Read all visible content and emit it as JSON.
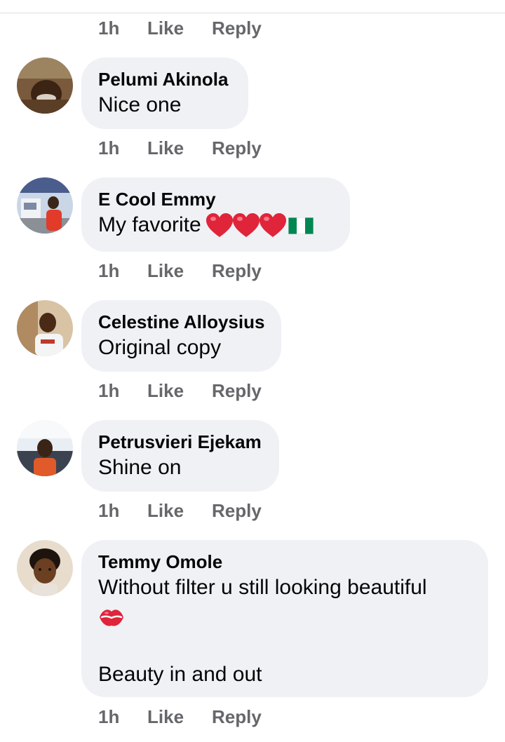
{
  "actions": {
    "time": "1h",
    "like": "Like",
    "reply": "Reply"
  },
  "comments": [
    {
      "author": "Pelumi Akinola",
      "text": "Nice one"
    },
    {
      "author": "E Cool Emmy",
      "text": "My favorite"
    },
    {
      "author": "Celestine Alloysius",
      "text": "Original copy"
    },
    {
      "author": "Petrusvieri Ejekam",
      "text": "Shine on"
    },
    {
      "author": "Temmy Omole",
      "text": "Without filter u still looking beautiful",
      "text2": "Beauty in and out"
    }
  ],
  "colors": {
    "bubble": "#eff1f5",
    "action_text": "#65676b",
    "name_text": "#050505",
    "heart": "#e0243a",
    "flag_green": "#008751"
  },
  "icons": [
    "heart-emoji-icon",
    "nigeria-flag-icon",
    "lips-emoji-icon"
  ]
}
